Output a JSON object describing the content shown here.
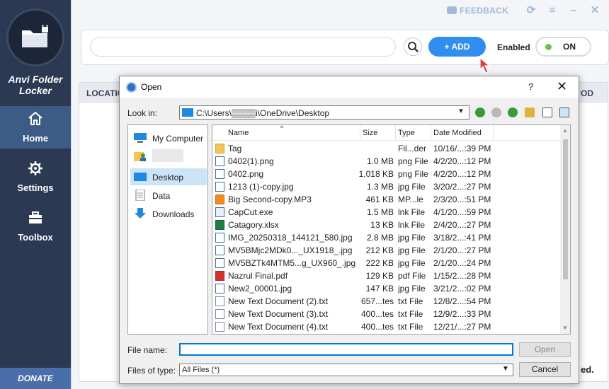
{
  "app": {
    "name_line1": "Anvi Folder",
    "name_line2": "Locker",
    "nav": [
      {
        "label": "Home",
        "icon": "home-icon",
        "active": true
      },
      {
        "label": "Settings",
        "icon": "gear-icon",
        "active": false
      },
      {
        "label": "Toolbox",
        "icon": "toolbox-icon",
        "active": false
      }
    ],
    "donate": "DONATE",
    "feedback": "FEEDBACK",
    "add_label": "ADD",
    "enabled_label": "Enabled",
    "toggle_label": "ON",
    "list_header_location": "LOCATIO",
    "list_header_right": "OD",
    "list_tail_text": "ed.",
    "colors": {
      "sidebar": "#2b3a52",
      "active": "#3e5a86",
      "add": "#2f8ef0",
      "on_dot": "#6cc04a"
    }
  },
  "dialog": {
    "title": "Open",
    "help": "?",
    "close": "✕",
    "look_in_label": "Look in:",
    "look_in_path": "C:\\Users\\▒▒▒▒i\\OneDrive\\Desktop",
    "places": [
      {
        "label": "My Computer",
        "icon": "computer-icon"
      },
      {
        "label": "",
        "icon": "user-folder-icon"
      },
      {
        "label": "Desktop",
        "icon": "desktop-icon",
        "selected": true
      },
      {
        "label": "Data",
        "icon": "document-icon"
      },
      {
        "label": "Downloads",
        "icon": "download-icon"
      }
    ],
    "columns": {
      "name": "Name",
      "size": "Size",
      "type": "Type",
      "modified": "Date Modified"
    },
    "files": [
      {
        "name": "Tag",
        "size": "",
        "type": "Fil...der",
        "modified": "10/16/...:39 PM",
        "icon": "folder"
      },
      {
        "name": "0402(1).png",
        "size": "1.0 MB",
        "type": "png File",
        "modified": "4/2/20...:12 PM",
        "icon": "img"
      },
      {
        "name": "0402.png",
        "size": "1,018 KB",
        "type": "png File",
        "modified": "4/2/20...:12 PM",
        "icon": "img"
      },
      {
        "name": "1213 (1)-copy.jpg",
        "size": "1.3 MB",
        "type": "jpg File",
        "modified": "3/20/2...:27 PM",
        "icon": "img"
      },
      {
        "name": "Big Second-copy.MP3",
        "size": "461 KB",
        "type": "MP...le",
        "modified": "2/3/20...:51 PM",
        "icon": "vlc"
      },
      {
        "name": "CapCut.exe",
        "size": "1.5 MB",
        "type": "lnk File",
        "modified": "4/1/20...:59 PM",
        "icon": "lnk"
      },
      {
        "name": "Catagory.xlsx",
        "size": "13 KB",
        "type": "lnk File",
        "modified": "2/4/20...:27 PM",
        "icon": "xls"
      },
      {
        "name": "IMG_20250318_144121_580.jpg",
        "size": "2.8 MB",
        "type": "jpg File",
        "modified": "3/18/2...:41 PM",
        "icon": "img"
      },
      {
        "name": "MV5BMjc2MDk0..._UX1918_.jpg",
        "size": "212 KB",
        "type": "jpg File",
        "modified": "2/1/20...:27 PM",
        "icon": "img"
      },
      {
        "name": "MV5BZTk4MTM5...g_UX960_.jpg",
        "size": "222 KB",
        "type": "jpg File",
        "modified": "2/1/20...:24 PM",
        "icon": "img"
      },
      {
        "name": "Nazrul Final.pdf",
        "size": "129 KB",
        "type": "pdf File",
        "modified": "1/15/2...:28 PM",
        "icon": "pdf"
      },
      {
        "name": "New2_00001.jpg",
        "size": "147 KB",
        "type": "jpg File",
        "modified": "3/21/2...:02 PM",
        "icon": "img"
      },
      {
        "name": "New Text Document (2).txt",
        "size": "657...tes",
        "type": "txt File",
        "modified": "12/8/2...:54 PM",
        "icon": "txt"
      },
      {
        "name": "New Text Document (3).txt",
        "size": "400...tes",
        "type": "txt File",
        "modified": "12/9/2...:33 PM",
        "icon": "txt"
      },
      {
        "name": "New Text Document (4).txt",
        "size": "400...tes",
        "type": "txt File",
        "modified": "12/21/...:27 PM",
        "icon": "txt"
      }
    ],
    "file_name_label": "File name:",
    "file_name_value": "",
    "open_label": "Open",
    "file_type_label": "Files of type:",
    "file_type_value": "All Files (*)",
    "cancel_label": "Cancel"
  }
}
